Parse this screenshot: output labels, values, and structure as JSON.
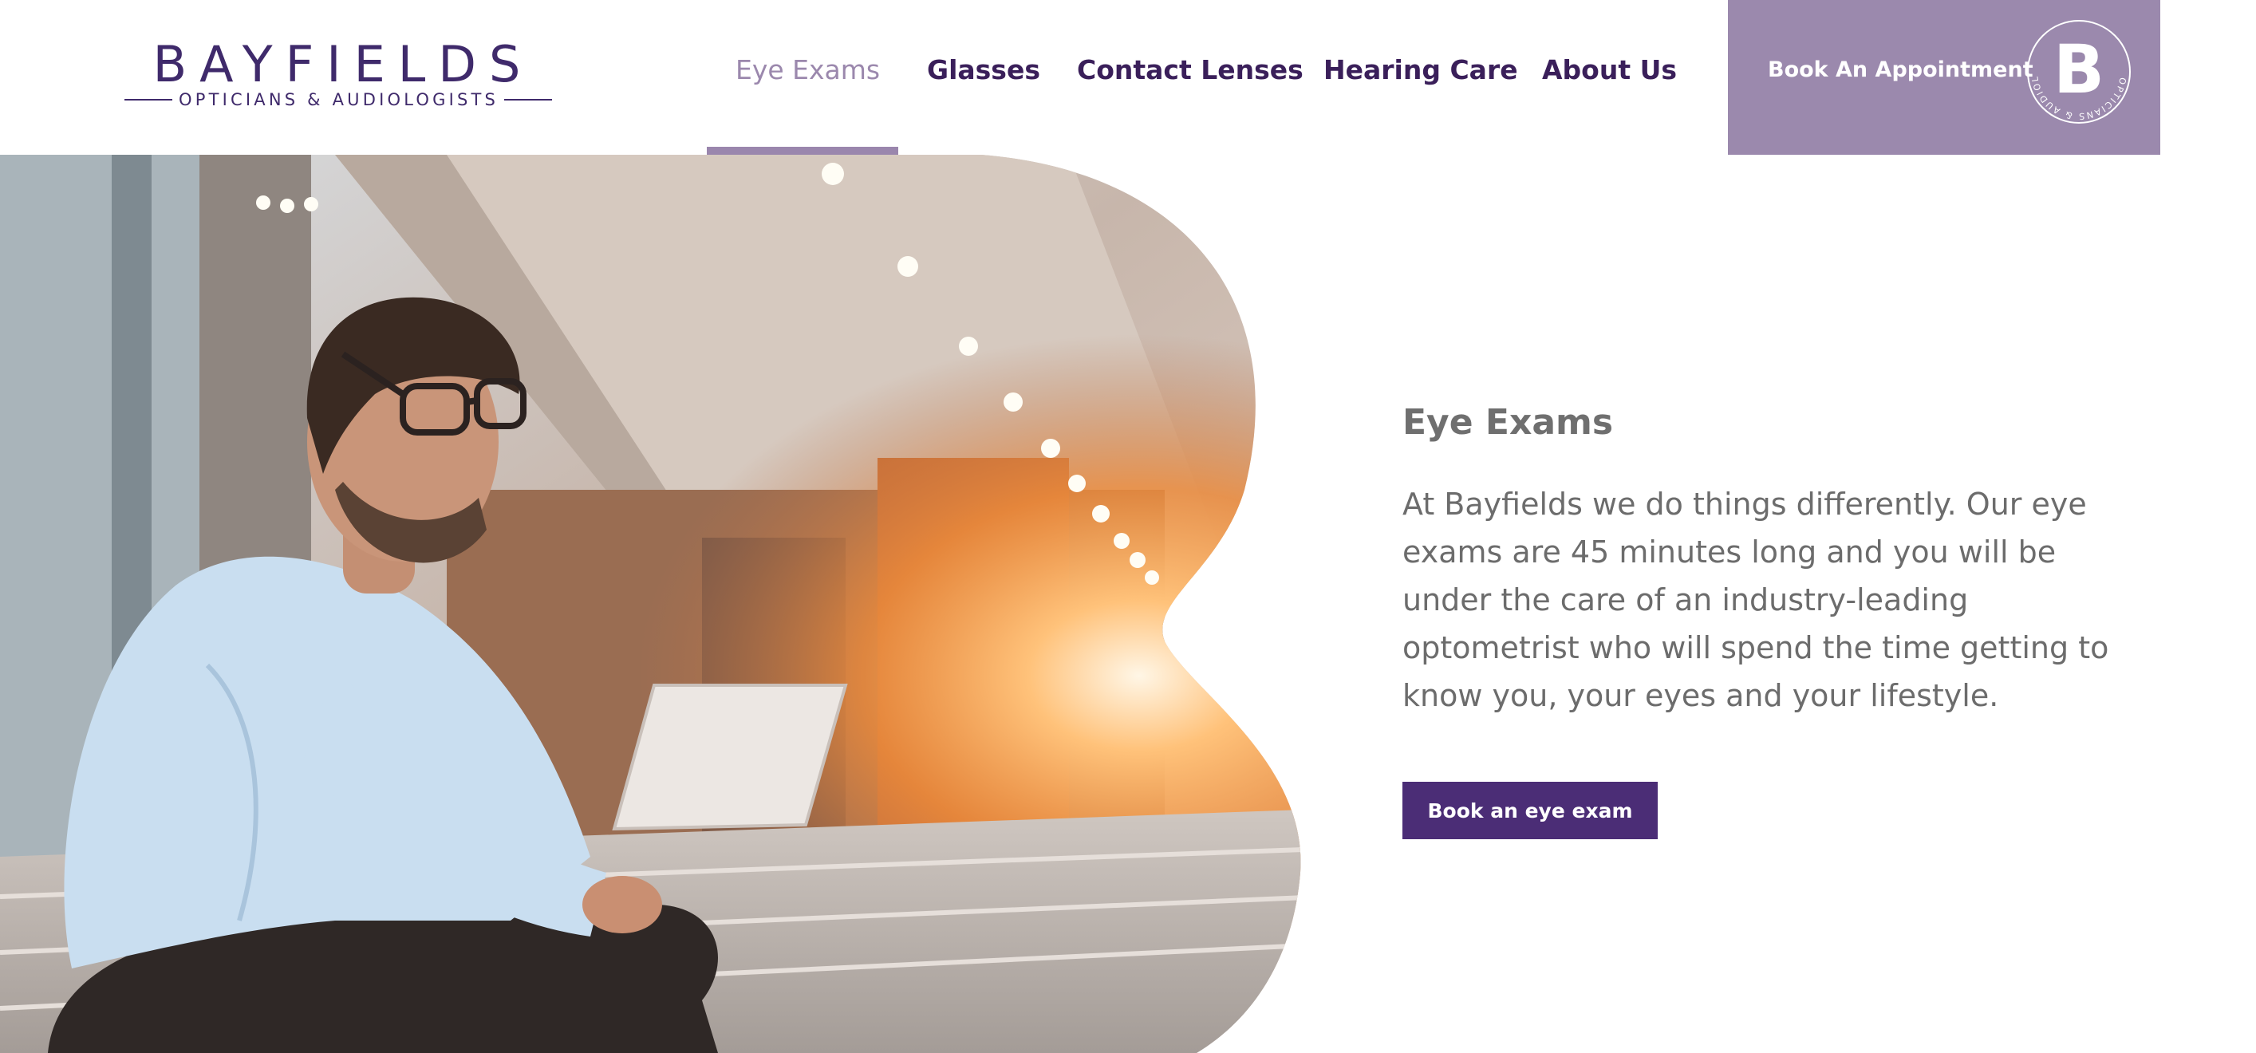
{
  "brand": {
    "name": "BAYFIELDS",
    "tagline": "OPTICIANS & AUDIOLOGISTS",
    "badge_letter": "B",
    "badge_ring_text": "OPTICIANS & AUDIOLOGISTS",
    "primary_color": "#4b2d76",
    "accent_color": "#9b89ad"
  },
  "nav": {
    "items": [
      {
        "label": "Eye Exams",
        "active": true
      },
      {
        "label": "Glasses",
        "active": false
      },
      {
        "label": "Contact Lenses",
        "active": false
      },
      {
        "label": "Hearing Care",
        "active": false
      },
      {
        "label": "About Us",
        "active": false
      }
    ],
    "cta_label": "Book An Appointment"
  },
  "hero": {
    "image_description_icon": "hero-photo-icon",
    "title": "Eye Exams",
    "body": "At Bayfields we do things differently. Our eye exams are 45 minutes long and you will be under the care of an industry-leading optometrist who will spend the time getting to know you, your eyes and your lifestyle.",
    "button_label": "Book an eye exam"
  }
}
